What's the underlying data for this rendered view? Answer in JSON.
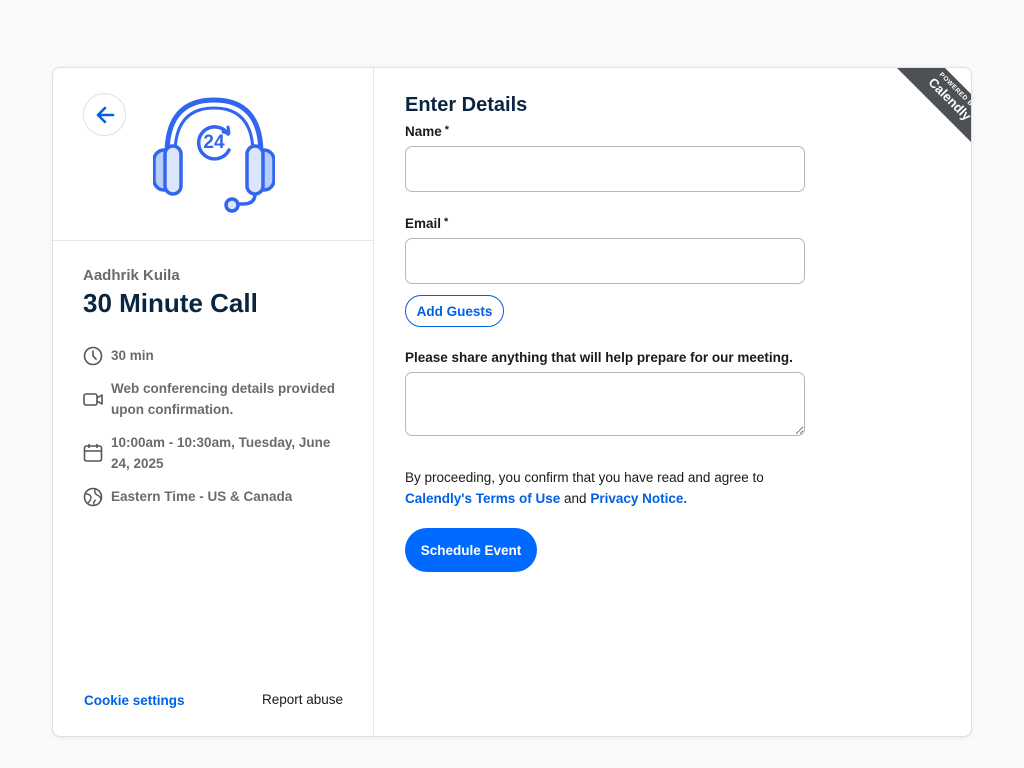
{
  "left_panel": {
    "organizer": "Aadhrik Kuila",
    "event_title": "30 Minute Call",
    "details": [
      {
        "icon": "clock-icon",
        "text": "30 min"
      },
      {
        "icon": "video-camera-icon",
        "text": "Web conferencing details provided upon confirmation."
      },
      {
        "icon": "calendar-icon",
        "text": "10:00am - 10:30am, Tuesday, June 24, 2025"
      },
      {
        "icon": "globe-icon",
        "text": "Eastern Time - US & Canada"
      }
    ],
    "cookie_settings": "Cookie settings",
    "report_abuse": "Report abuse",
    "logo_icon": "headset-24-icon",
    "back_icon": "arrow-left-icon"
  },
  "form": {
    "title": "Enter Details",
    "name_label": "Name",
    "name_value": "",
    "email_label": "Email",
    "email_value": "",
    "required_marker": "*",
    "add_guests": "Add Guests",
    "share_label": "Please share anything that will help prepare for our meeting.",
    "share_value": "",
    "terms_prefix": "By proceeding, you confirm that you have read and agree to",
    "terms_link": "Calendly's Terms of Use",
    "terms_and": "and",
    "privacy_link": "Privacy Notice.",
    "schedule_button": "Schedule Event"
  },
  "ribbon": {
    "small": "POWERED BY",
    "big": "Calendly"
  },
  "colors": {
    "accent": "#0069ff",
    "link": "#0060e6",
    "title": "#0a2540",
    "ribbon": "#4d5055"
  }
}
